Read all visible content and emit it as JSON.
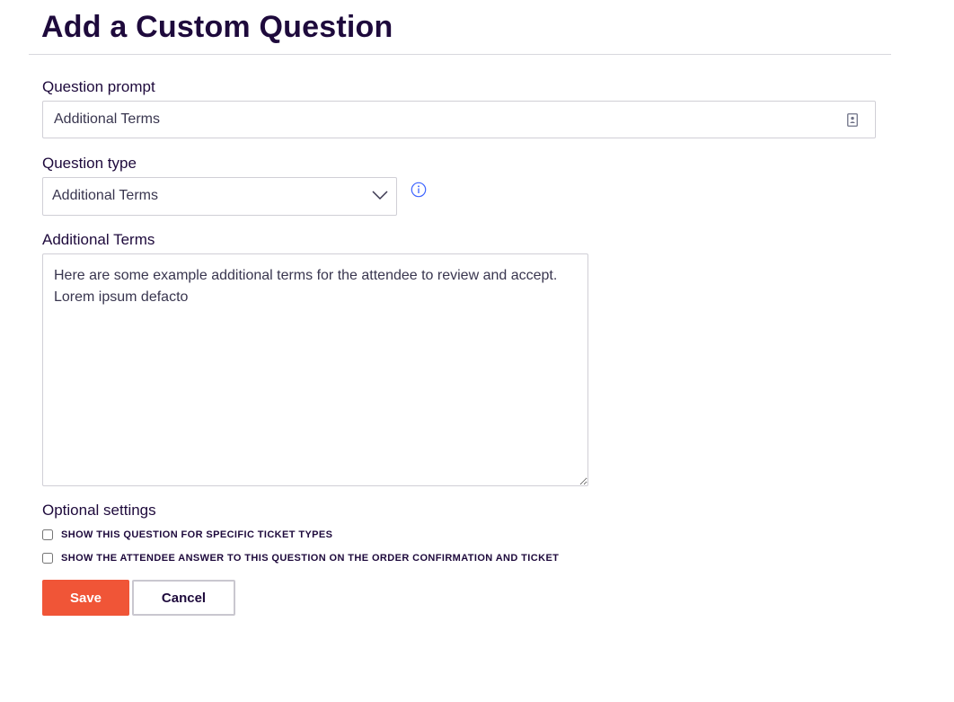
{
  "page": {
    "title": "Add a Custom Question"
  },
  "question_prompt": {
    "label": "Question prompt",
    "value": "Additional Terms",
    "icon": "contact-card-icon"
  },
  "question_type": {
    "label": "Question type",
    "selected": "Additional Terms",
    "info_icon": "info-icon"
  },
  "additional_terms": {
    "label": "Additional Terms",
    "value": "Here are some example additional terms for the attendee to review and accept. Lorem ipsum defacto"
  },
  "optional_settings": {
    "label": "Optional settings",
    "options": [
      {
        "label": "SHOW THIS QUESTION FOR SPECIFIC TICKET TYPES",
        "checked": false
      },
      {
        "label": "SHOW THE ATTENDEE ANSWER TO THIS QUESTION ON THE ORDER CONFIRMATION AND TICKET",
        "checked": false
      }
    ]
  },
  "actions": {
    "save_label": "Save",
    "cancel_label": "Cancel"
  },
  "colors": {
    "primary_text": "#1e0a3c",
    "accent": "#f05537",
    "info_blue": "#3d64ff"
  }
}
